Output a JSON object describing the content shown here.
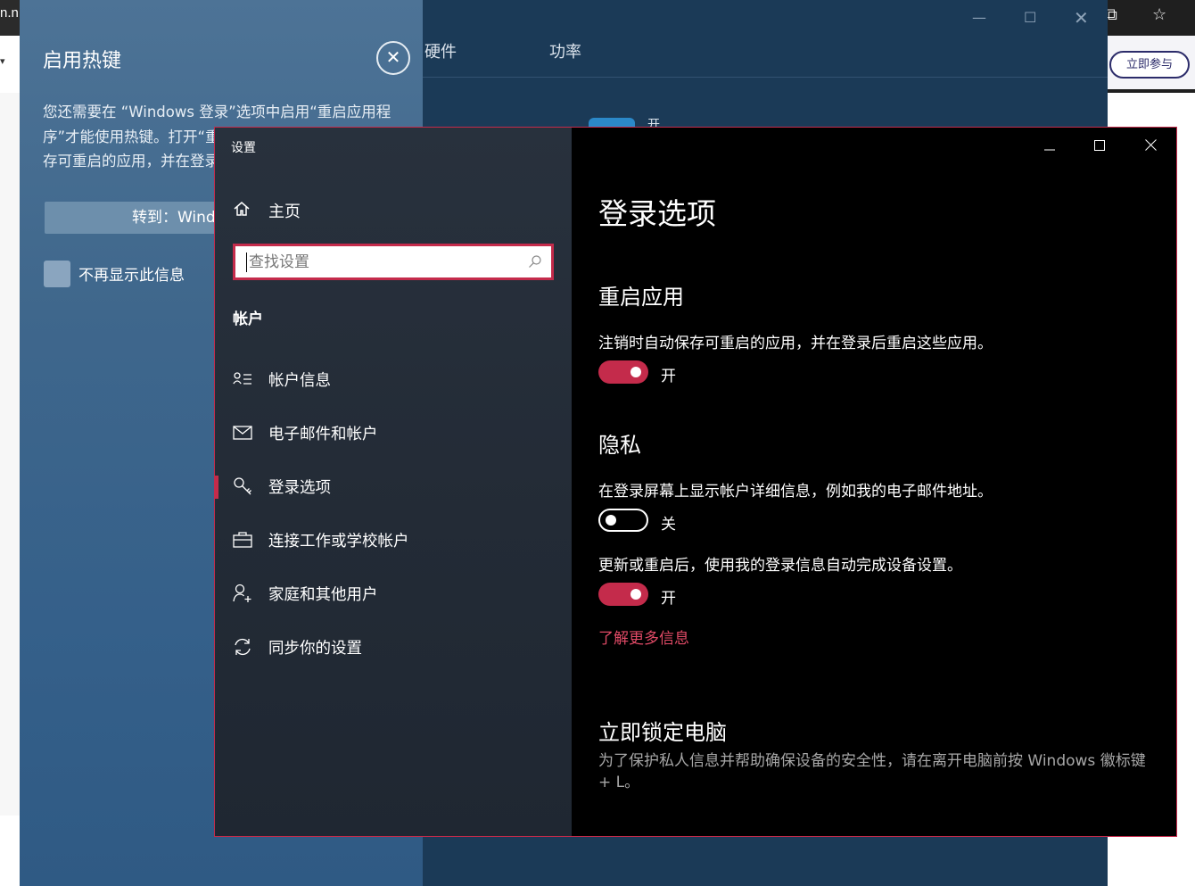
{
  "browser": {
    "tab_fragment": "n.n",
    "join_button": "立即参与"
  },
  "background_app": {
    "tabs": [
      "硬件",
      "功率"
    ],
    "peek_text": "开"
  },
  "hotkey_panel": {
    "title": "启用热键",
    "description": "您还需要在 “Windows 登录”选项中启用“重启应用程序”才能使用热键。打开“重启应用程序（退出时自动保存可重启的应用，并在登录后重新启动）",
    "goto_button": "转到：Windows 登录选项",
    "dont_show_label": "不再显示此信息"
  },
  "settings": {
    "window_title": "设置",
    "home_label": "主页",
    "search_placeholder": "查找设置",
    "section_header": "帐户",
    "nav_items": [
      {
        "label": "帐户信息",
        "icon": "account-info-icon"
      },
      {
        "label": "电子邮件和帐户",
        "icon": "mail-icon"
      },
      {
        "label": "登录选项",
        "icon": "key-icon",
        "selected": true
      },
      {
        "label": "连接工作或学校帐户",
        "icon": "briefcase-icon"
      },
      {
        "label": "家庭和其他用户",
        "icon": "add-person-icon"
      },
      {
        "label": "同步你的设置",
        "icon": "sync-icon"
      }
    ],
    "page_title": "登录选项",
    "restart_apps": {
      "title": "重启应用",
      "description": "注销时自动保存可重启的应用，并在登录后重启这些应用。",
      "toggle_on": true,
      "state_label": "开"
    },
    "privacy": {
      "title": "隐私",
      "show_details_text": "在登录屏幕上显示帐户详细信息，例如我的电子邮件地址。",
      "show_details_on": false,
      "show_details_state": "关",
      "auto_finish_text": "更新或重启后，使用我的登录信息自动完成设备设置。",
      "auto_finish_on": true,
      "auto_finish_state": "开",
      "learn_more": "了解更多信息"
    },
    "lock_pc": {
      "title": "立即锁定电脑",
      "description": "为了保护私人信息并帮助确保设备的安全性，请在离开电脑前按 Windows 徽标键 + L。"
    },
    "accent_color": "#c42b4b"
  }
}
